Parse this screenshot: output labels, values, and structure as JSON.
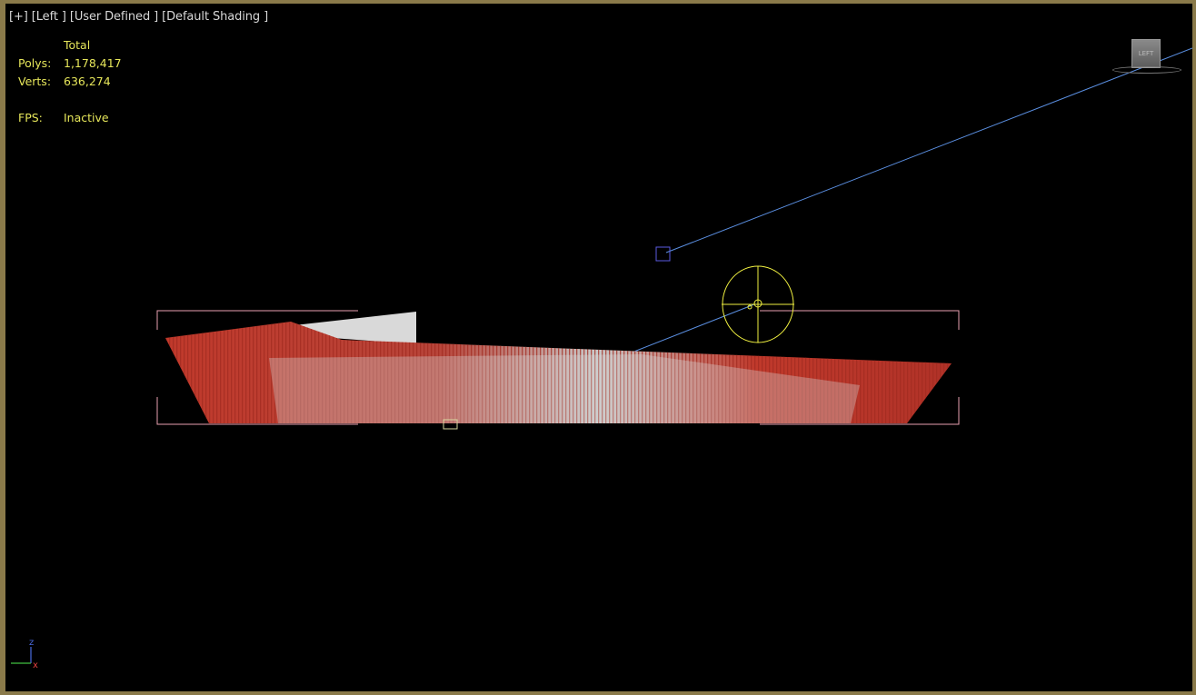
{
  "viewport": {
    "menu": {
      "plus": "[+]",
      "view": "[Left ]",
      "camera": "[User Defined ]",
      "shading": "[Default Shading ]"
    },
    "stats": {
      "column_header": "Total",
      "polys_label": "Polys:",
      "polys_value": "1,178,417",
      "verts_label": "Verts:",
      "verts_value": "636,274",
      "fps_label": "FPS:",
      "fps_value": "Inactive"
    },
    "viewcube_label": "LEFT",
    "axis": {
      "z": "z",
      "x": "x"
    }
  },
  "colors": {
    "border": "#8a7a4a",
    "stats_text": "#e6e65a",
    "menu_text": "#d8d8d8",
    "object_red": "#c0392b",
    "object_white": "#d9d9d9",
    "bbox": "#e8a0b0",
    "light_line": "#5a8ee0",
    "light_gizmo": "#f0f040"
  }
}
